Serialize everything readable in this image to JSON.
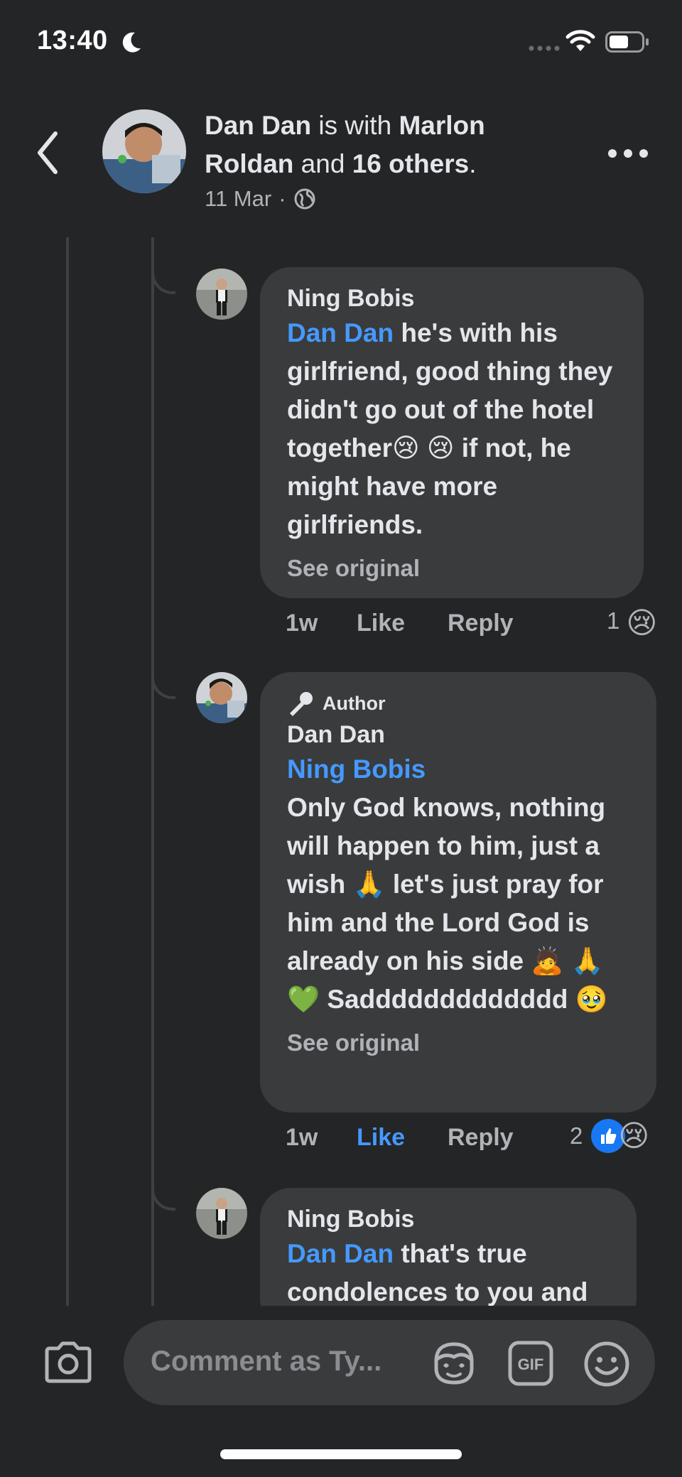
{
  "status_bar": {
    "time": "13:40"
  },
  "header": {
    "author": "Dan Dan",
    "with_text": "is with",
    "tagged": "Marlon Roldan",
    "and_text": "and",
    "others": "16 others",
    "period": ".",
    "date": "11 Mar",
    "separator": "·"
  },
  "comments": [
    {
      "name": "Ning Bobis",
      "mention": "Dan Dan",
      "text": "he's with his girlfriend, good thing they didn't go out of the hotel together😢 😢 if not, he might have more girlfriends.",
      "see_original": "See original",
      "time": "1w",
      "like": "Like",
      "reply": "Reply",
      "reaction_count": "1",
      "reactions": [
        "😢"
      ]
    },
    {
      "badge": "Author",
      "name": "Dan Dan",
      "mention": "Ning Bobis",
      "text": "Only God knows, nothing will happen to him, just a wish 🙏 let's just pray for him and the Lord God is already on his side 🙇 🙏💚 Saddddddddddddd 🥹",
      "see_original": "See original",
      "time": "1w",
      "like": "Like",
      "reply": "Reply",
      "reaction_count": "2",
      "reactions": [
        "👍",
        "😢"
      ],
      "liked": true
    },
    {
      "name": "Ning Bobis",
      "mention": "Dan Dan",
      "text": "that's true condolences to you and"
    }
  ],
  "composer": {
    "placeholder": "Comment as Ty..."
  },
  "colors": {
    "background": "#242526",
    "bubble": "#3a3b3c",
    "accent": "#4599ff",
    "muted": "#b0b3b8"
  },
  "icons": [
    "back-icon",
    "more-icon",
    "globe-icon",
    "camera-icon",
    "avatar-sticker-icon",
    "gif-icon",
    "emoji-icon",
    "microphone-icon"
  ]
}
